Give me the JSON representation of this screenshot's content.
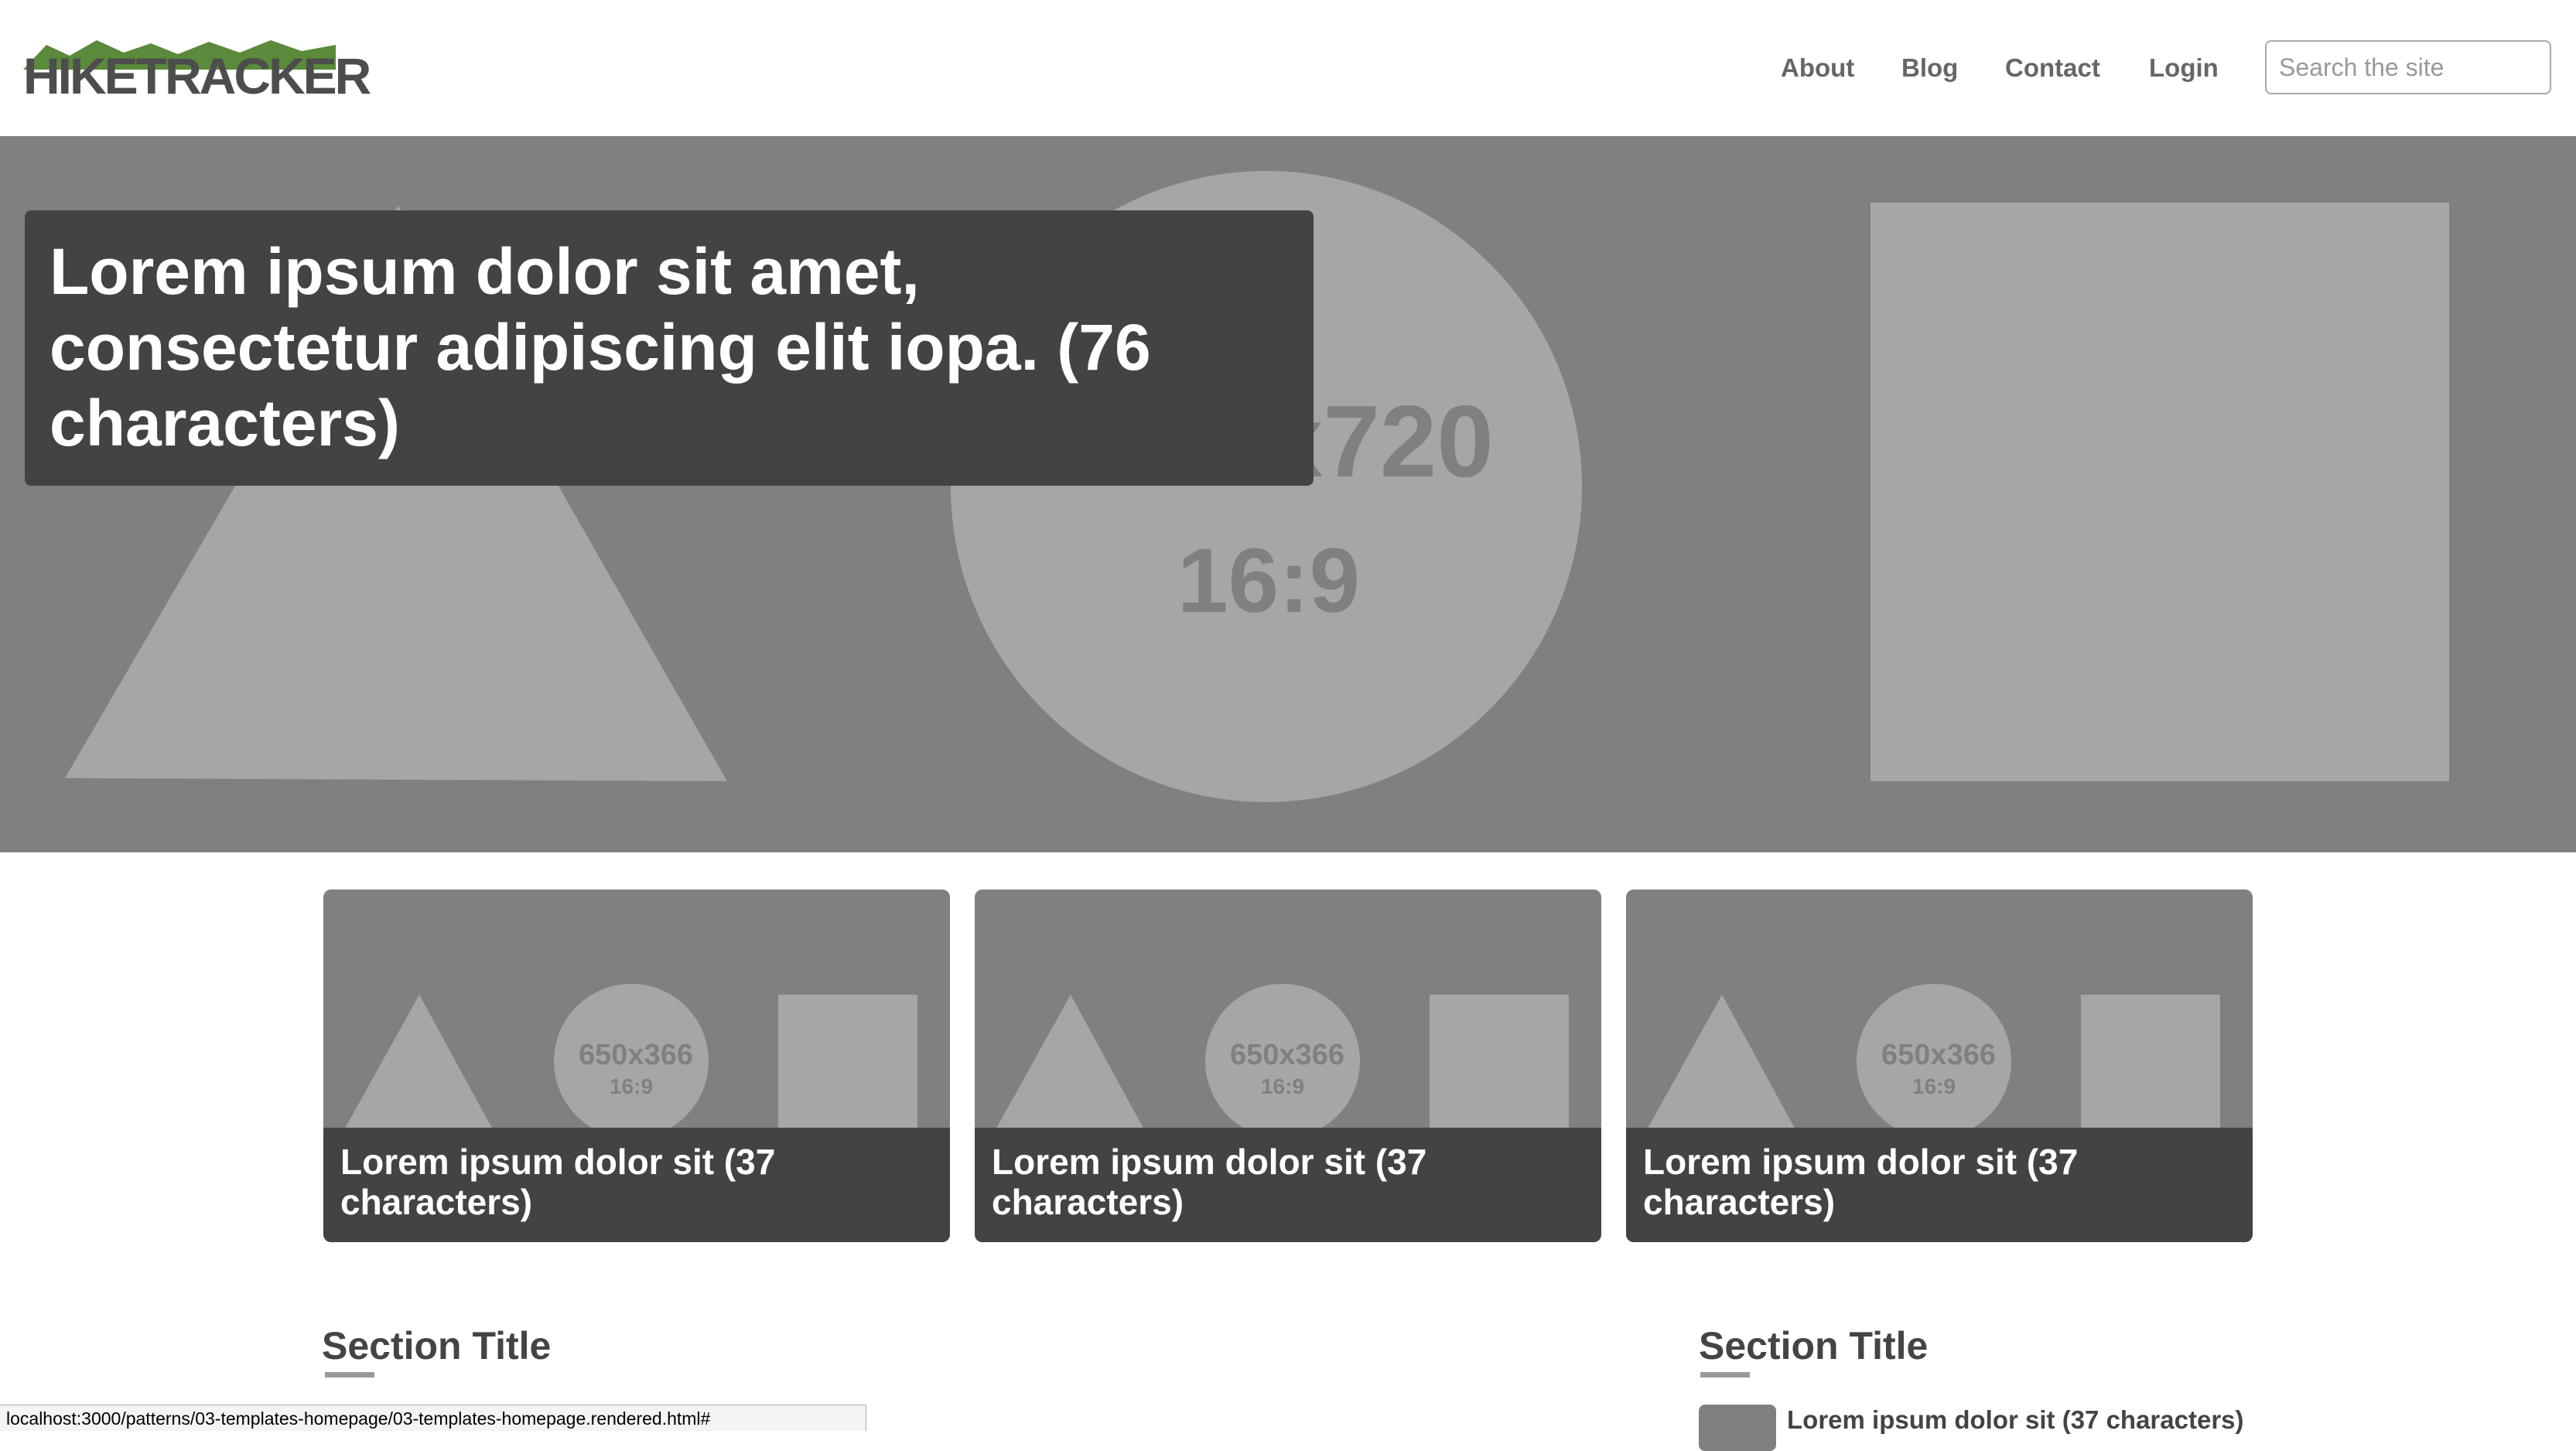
{
  "header": {
    "logo_text": "HIKETRACKER",
    "nav": [
      "About",
      "Blog",
      "Contact",
      "Login"
    ],
    "search_placeholder": "Search the site"
  },
  "hero": {
    "title": "Lorem ipsum dolor sit amet, consectetur adipiscing elit iopa. (76 characters)",
    "placeholder_size": "1280x720",
    "placeholder_ratio": "16:9"
  },
  "cards": [
    {
      "title": "Lorem ipsum dolor sit (37 characters)",
      "placeholder_size": "650x366",
      "placeholder_ratio": "16:9"
    },
    {
      "title": "Lorem ipsum dolor sit (37 characters)",
      "placeholder_size": "650x366",
      "placeholder_ratio": "16:9"
    },
    {
      "title": "Lorem ipsum dolor sit (37 characters)",
      "placeholder_size": "650x366",
      "placeholder_ratio": "16:9"
    }
  ],
  "sections": [
    {
      "title": "Section Title"
    },
    {
      "title": "Section Title",
      "items": [
        {
          "title": "Lorem ipsum dolor sit (37 characters)"
        }
      ]
    }
  ],
  "status_bar": {
    "url": "localhost:3000/patterns/03-templates-homepage/03-templates-homepage.rendered.html#"
  },
  "colors": {
    "placeholder_bg": "#808080",
    "placeholder_shape": "#a6a6a6",
    "caption_bg": "#434343",
    "logo_green": "#5a8a3a",
    "text": "#444444"
  }
}
